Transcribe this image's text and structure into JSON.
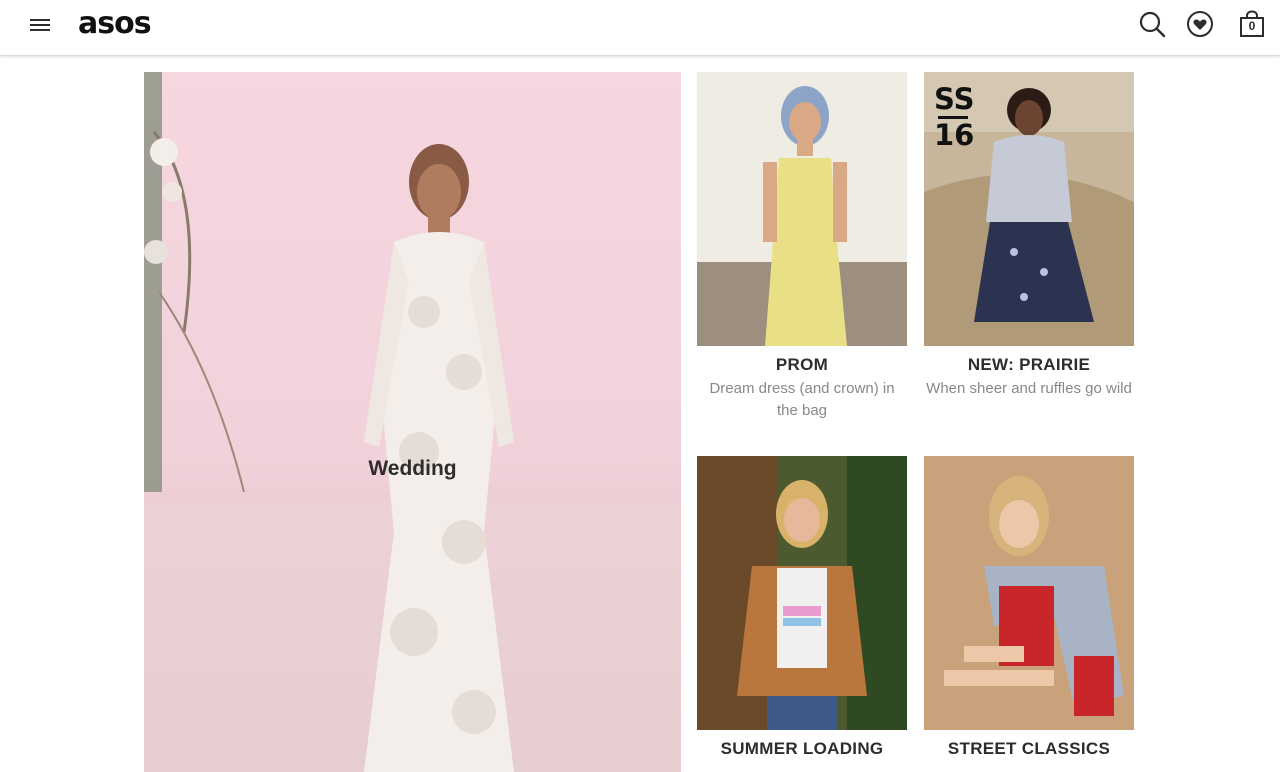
{
  "header": {
    "logo_text": "asos",
    "bag_count": "0",
    "icons": [
      "menu-icon",
      "search-icon",
      "heart-icon",
      "bag-icon"
    ]
  },
  "hero": {
    "label": "Wedding"
  },
  "tiles": [
    {
      "title": "PROM",
      "desc": "Dream dress (and crown) in the bag"
    },
    {
      "title": "NEW: PRAIRIE",
      "desc": "When sheer and ruffles go wild",
      "badge_top": "SS",
      "badge_bottom": "16"
    },
    {
      "title": "SUMMER LOADING",
      "desc": ""
    },
    {
      "title": "STREET CLASSICS",
      "desc": ""
    }
  ],
  "colors": {
    "text": "#2d2d2d",
    "muted": "#888888",
    "divider": "#d9d9d9"
  }
}
